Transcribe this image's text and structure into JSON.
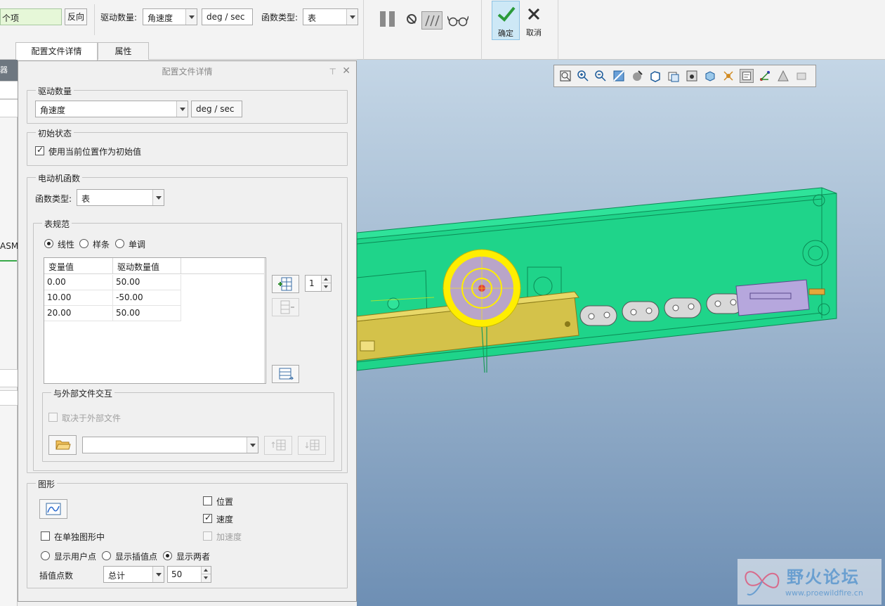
{
  "ribbon": {
    "item_field": "个项",
    "reverse_button": "反向",
    "drive_quantity_label": "驱动数量:",
    "drive_quantity_value": "角速度",
    "unit_value": "deg / sec",
    "function_type_label": "函数类型:",
    "function_type_value": "表",
    "ok_label": "确定",
    "cancel_label": "取消",
    "tabs": [
      "配置文件详情",
      "属性"
    ]
  },
  "left_strip": {
    "header": "器",
    "asm": "ASM"
  },
  "dialog": {
    "title": "配置文件详情",
    "drive_group": {
      "title": "驱动数量",
      "quantity": "角速度",
      "unit": "deg / sec"
    },
    "initial_group": {
      "title": "初始状态",
      "use_current_label": "使用当前位置作为初始值",
      "use_current_checked": true
    },
    "motor_group": {
      "title": "电动机函数",
      "function_type_label": "函数类型:",
      "function_type_value": "表",
      "table_spec": {
        "title": "表规范",
        "radios": [
          {
            "label": "线性",
            "checked": true
          },
          {
            "label": "样条",
            "checked": false
          },
          {
            "label": "单调",
            "checked": false
          }
        ],
        "columns": [
          "变量值",
          "驱动数量值"
        ],
        "rows": [
          [
            "0.00",
            "50.00"
          ],
          [
            "10.00",
            "-50.00"
          ],
          [
            "20.00",
            "50.00"
          ]
        ],
        "row_count": "1"
      },
      "external": {
        "title": "与外部文件交互",
        "depends_label": "取决于外部文件",
        "depends_checked": false,
        "file_value": ""
      }
    },
    "graph_group": {
      "title": "图形",
      "position_label": "位置",
      "position_checked": false,
      "velocity_label": "速度",
      "velocity_checked": true,
      "acceleration_label": "加速度",
      "acceleration_checked": false,
      "separate_label": "在单独图形中",
      "separate_checked": false,
      "display_radios": [
        {
          "label": "显示用户点",
          "checked": false
        },
        {
          "label": "显示插值点",
          "checked": false
        },
        {
          "label": "显示两者",
          "checked": true
        }
      ],
      "interp_label": "插值点数",
      "interp_mode": "总计",
      "interp_count": "50"
    }
  },
  "watermark": {
    "site_cn": "野火论坛",
    "site_url": "www.proewildfire.cn"
  },
  "colors": {
    "part_green": "#1fd48a",
    "gear_yellow": "#ffee00",
    "gear_body": "#b9a5c8",
    "rack_gold": "#d4c24a",
    "ok_highlight": "#cde8f6"
  }
}
